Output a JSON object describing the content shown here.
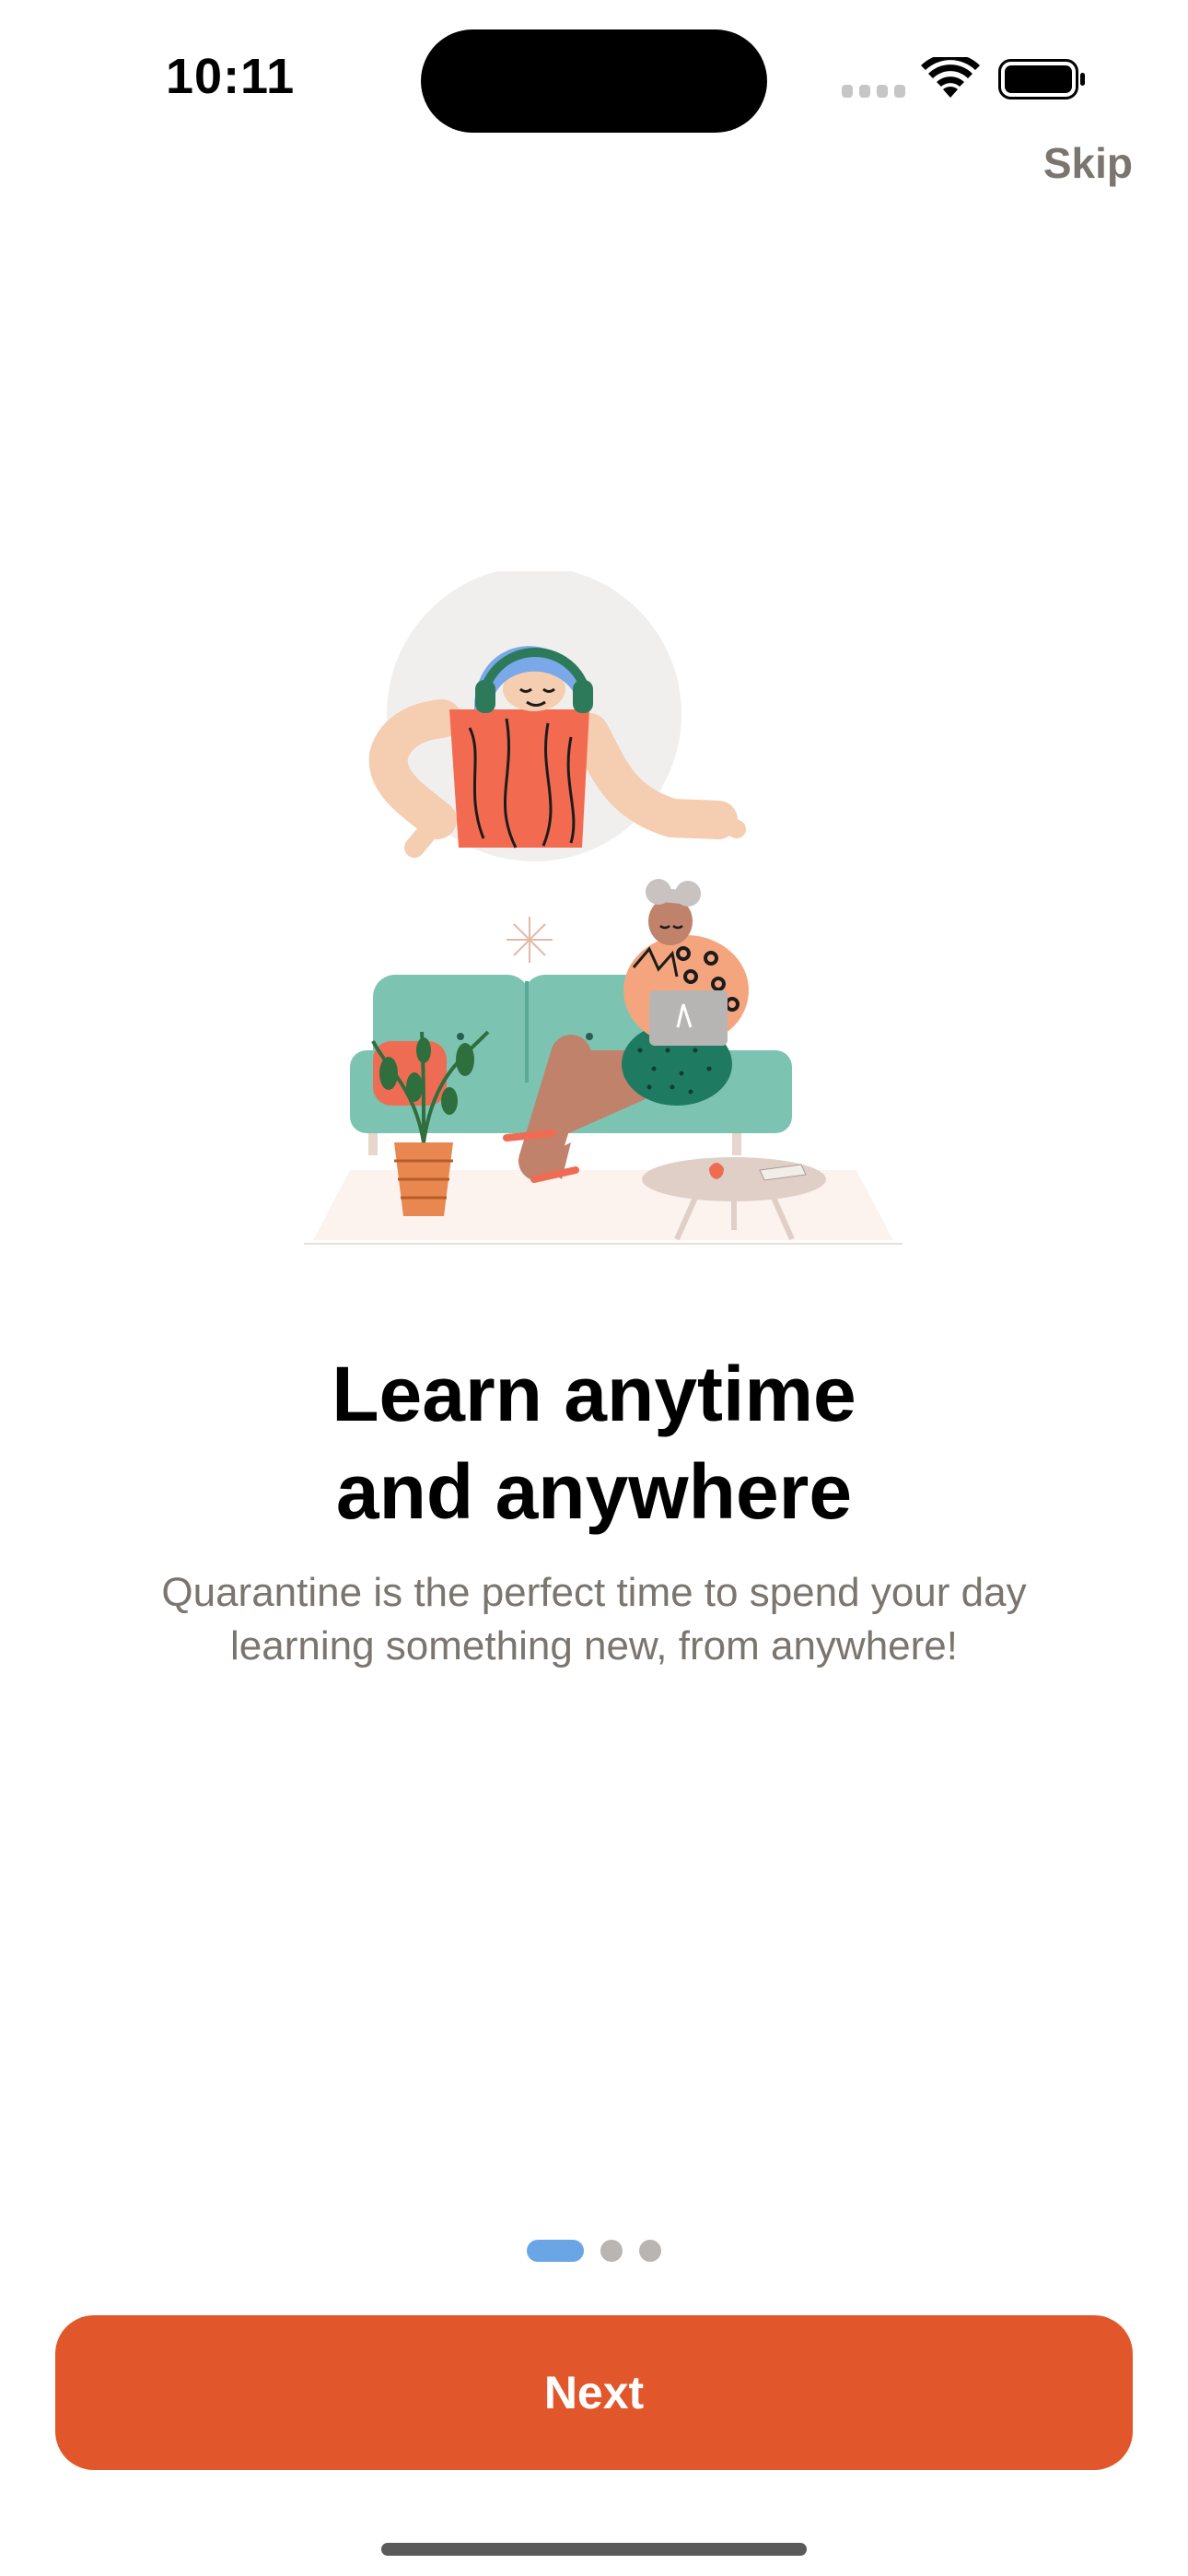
{
  "status_bar": {
    "time": "10:11"
  },
  "header": {
    "skip_label": "Skip"
  },
  "onboarding": {
    "title_line1": "Learn anytime",
    "title_line2": "and anywhere",
    "subtitle_line1": "Quarantine is the perfect time to spend your day",
    "subtitle_line2": "learning something new, from anywhere!",
    "page_count": 3,
    "current_page": 1
  },
  "footer": {
    "next_label": "Next"
  },
  "icons": {
    "signal": "cellular-signal-icon",
    "wifi": "wifi-icon",
    "battery": "battery-icon"
  },
  "colors": {
    "accent": "#e2562b",
    "page_indicator_active": "#6aa6e6",
    "page_indicator_inactive": "#b9b5b1",
    "secondary_text": "#7a756e"
  }
}
